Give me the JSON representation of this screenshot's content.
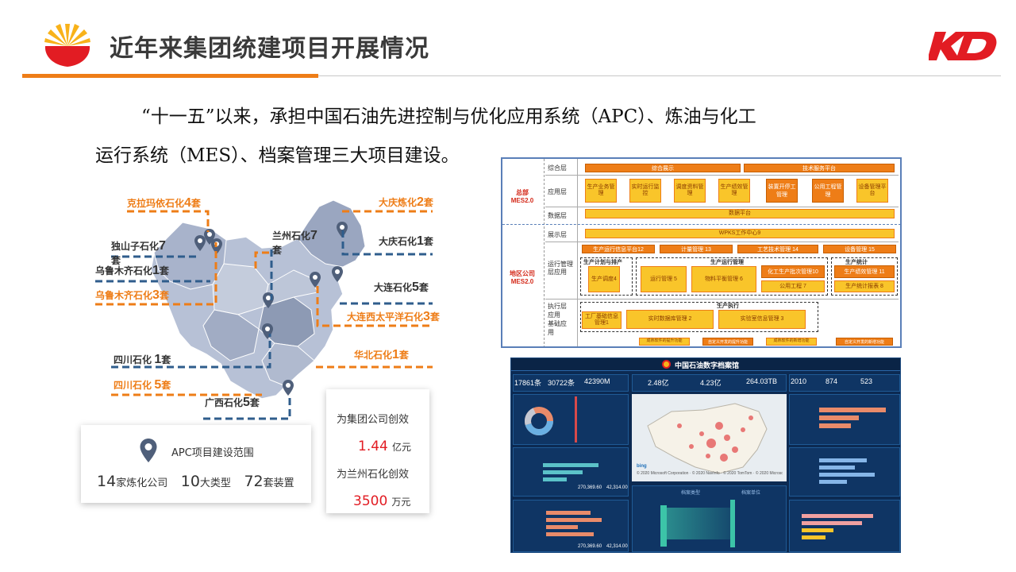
{
  "header": {
    "title": "近年来集团统建项目开展情况",
    "logo_right": "KD"
  },
  "intro": {
    "line1": "“十一五”以来，承担中国石油先进控制与优化应用系统（APC）、炼油与化工",
    "line2": "运行系统（MES）、档案管理三大项目建设。"
  },
  "map": {
    "labels": [
      {
        "name": "克拉玛依石化",
        "count": "4",
        "unit": "套",
        "style": "org"
      },
      {
        "name": "独山子石化",
        "count": "7",
        "unit": "套",
        "style": "dk"
      },
      {
        "name": "乌鲁木齐石化",
        "count": "1",
        "unit": "套",
        "style": "dk"
      },
      {
        "name": "乌鲁木齐石化",
        "count": "3",
        "unit": "套",
        "style": "org"
      },
      {
        "name": "兰州石化",
        "count": "7",
        "unit": "套",
        "style": "dk"
      },
      {
        "name": "大庆炼化",
        "count": "2",
        "unit": "套",
        "style": "org"
      },
      {
        "name": "大庆石化",
        "count": "1",
        "unit": "套",
        "style": "dk"
      },
      {
        "name": "大连石化",
        "count": "5",
        "unit": "套",
        "style": "dk"
      },
      {
        "name": "大连西太平洋石化",
        "count": "3",
        "unit": "套",
        "style": "org"
      },
      {
        "name": "华北石化",
        "count": "1",
        "unit": "套",
        "style": "org"
      },
      {
        "name": "四川石化 ",
        "count": "1",
        "unit": "套",
        "style": "dk"
      },
      {
        "name": "四川石化 ",
        "count": "5",
        "unit": "套",
        "style": "org"
      },
      {
        "name": "广西石化",
        "count": "5",
        "unit": "套",
        "style": "dk"
      }
    ]
  },
  "apc_card": {
    "title": "APC项目建设范围",
    "s1n": "14",
    "s1u": "家炼化公司",
    "s2n": "10",
    "s2u": "大类型",
    "s3n": "72",
    "s3u": "套装置"
  },
  "benefit_card": {
    "l1": "为集团公司创效",
    "v1": "1.44",
    "u1": "亿元",
    "l2": "为兰州石化创效",
    "v2": "3500",
    "u2": "万元"
  },
  "mes": {
    "hq_label": "总部\nMES2.0",
    "region_label": "地区公司\nMES2.0",
    "layers": [
      "综合层",
      "应用层",
      "数据层",
      "展示层",
      "运行管理层应用",
      "执行层应用",
      "基础应用"
    ],
    "top_boxes": [
      "综合展示",
      "技术服务平台"
    ],
    "apps": [
      "生产业务管理",
      "实时运行监控",
      "调度资料管理",
      "生产绩效管理",
      "装置开停工管理",
      "公用工程管理",
      "设备管理平台"
    ],
    "data_platform": "数据平台",
    "wpks": "WPKS工作中心9",
    "ops": [
      "生产运行信息平台12",
      "计量管理 13",
      "工艺技术管理 14",
      "设备管理 15"
    ],
    "groups": [
      "生产计划与排产",
      "生产运行管理",
      "生产统计",
      "生产执行"
    ],
    "sub": [
      "生产调度4",
      "运行管理 5",
      "物料平衡管理 6",
      "化工生产批次管理10",
      "公用工程 7",
      "生产绩效管理 11",
      "生产统计报表 8",
      "工厂基础信息管理1",
      "实时数据库管理 2",
      "实验室信息管理 3"
    ],
    "footer": [
      "成熟软件的提升功能",
      "自定义开发的提升功能",
      "成熟软件的新增功能",
      "自定义开发的新增功能"
    ]
  },
  "dash": {
    "title": "中国石油数字档案馆",
    "stats1": [
      "17861条",
      "30722条",
      "42390M"
    ],
    "stats2": [
      "2.48亿",
      "4.23亿",
      "264.03TB"
    ],
    "stats3": [
      "2010",
      "874",
      "523"
    ],
    "map_note": "© 2020 Microsoft Corporation · © 2020 NavInfo · © 2020 TomTom · © 2020 Microsoft Corporation",
    "bing": "bing",
    "totals": [
      "270,369.60",
      "42,314.00"
    ],
    "panels": [
      "档案类型",
      "档案单位"
    ]
  },
  "colors": {
    "accent": "#ee7d17",
    "map_fill": "#b7c1d6",
    "map_dark": "#8d9ab4",
    "line_blue": "#2f5d8c",
    "dash_bg": "#0c2a52"
  }
}
